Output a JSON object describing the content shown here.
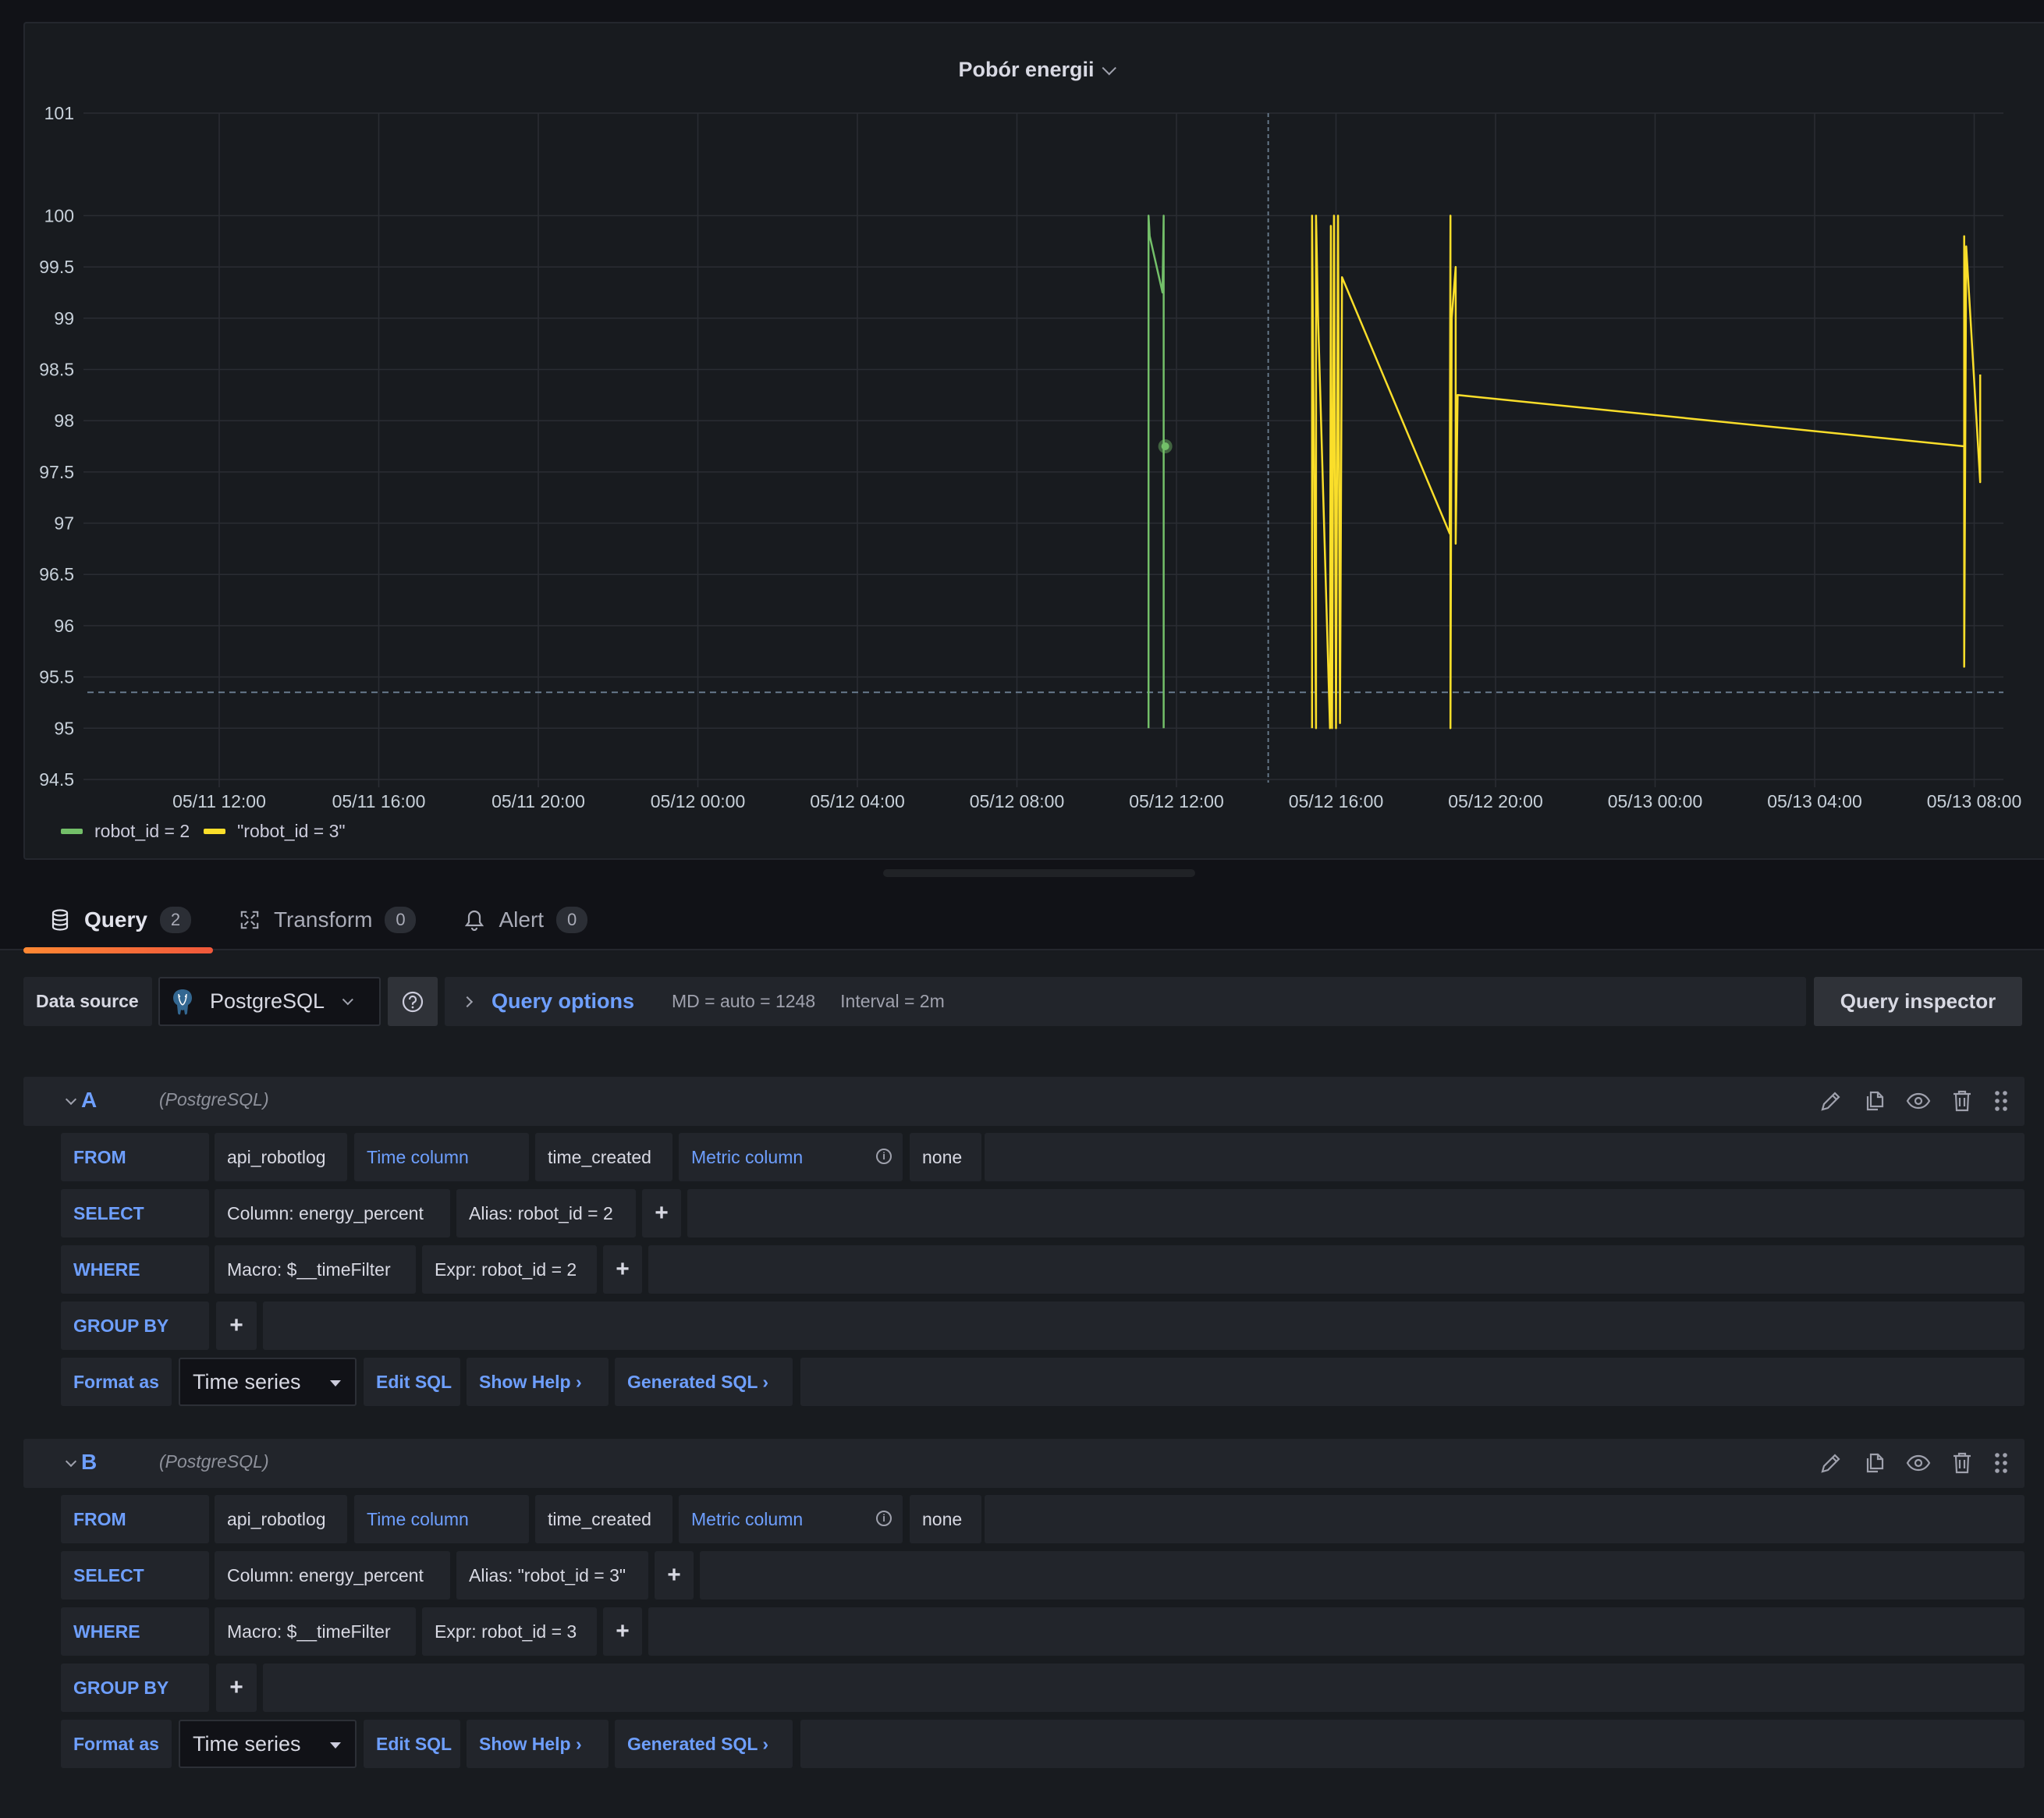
{
  "panel": {
    "title": "Pobór energii"
  },
  "chart_data": {
    "type": "line",
    "title": "Pobór energii",
    "xlabel": "",
    "ylabel": "",
    "ylim": [
      94.5,
      101
    ],
    "y_ticks": [
      "101",
      "100",
      "99.5",
      "99",
      "98.5",
      "98",
      "97.5",
      "97",
      "96.5",
      "96",
      "95.5",
      "95",
      "94.5"
    ],
    "y_tick_values": [
      101,
      100,
      99.5,
      99,
      98.5,
      98,
      97.5,
      97,
      96.5,
      96,
      95.5,
      95,
      94.5
    ],
    "x_ticks": [
      "05/11 12:00",
      "05/11 16:00",
      "05/11 20:00",
      "05/12 00:00",
      "05/12 04:00",
      "05/12 08:00",
      "05/12 12:00",
      "05/12 16:00",
      "05/12 20:00",
      "05/13 00:00",
      "05/13 04:00",
      "05/13 08:00"
    ],
    "x_unit": "hours since 05/11 12:00",
    "grid": true,
    "legend_position": "bottom-left",
    "crosshair_hours": 26.3,
    "crosshair_y": 95.35,
    "series": [
      {
        "name": "robot_id = 2",
        "color": "#73bf69",
        "points": [
          [
            23.3,
            95.0
          ],
          [
            23.3,
            100.0
          ],
          [
            23.33,
            99.8
          ],
          [
            23.65,
            99.25
          ],
          [
            23.68,
            100.0
          ],
          [
            23.68,
            95.0
          ]
        ],
        "highlight": [
          23.68,
          97.75
        ]
      },
      {
        "name": "\"robot_id = 3\"",
        "color": "#fade2a",
        "points": [
          [
            27.4,
            95.0
          ],
          [
            27.4,
            100.0
          ],
          [
            27.5,
            95.0
          ],
          [
            27.5,
            100.0
          ],
          [
            27.55,
            99.0
          ],
          [
            27.85,
            95.0
          ],
          [
            27.87,
            99.9
          ],
          [
            27.9,
            95.0
          ],
          [
            27.95,
            100.0
          ],
          [
            28.0,
            95.0
          ],
          [
            28.05,
            100.0
          ],
          [
            28.1,
            95.05
          ],
          [
            28.15,
            99.4
          ],
          [
            30.85,
            96.9
          ],
          [
            30.87,
            100.0
          ],
          [
            30.87,
            95.0
          ],
          [
            30.9,
            99.0
          ],
          [
            31.0,
            99.5
          ],
          [
            31.0,
            96.8
          ],
          [
            31.05,
            98.25
          ],
          [
            43.75,
            97.75
          ],
          [
            43.75,
            99.8
          ],
          [
            43.75,
            95.6
          ],
          [
            43.8,
            99.7
          ],
          [
            44.15,
            97.4
          ],
          [
            44.15,
            98.45
          ]
        ]
      }
    ]
  },
  "legend": [
    {
      "label": "robot_id = 2",
      "color": "#73bf69"
    },
    {
      "label": "\"robot_id = 3\"",
      "color": "#fade2a"
    }
  ],
  "tabs": [
    {
      "label": "Query",
      "count": "2",
      "icon": "database-icon",
      "active": true
    },
    {
      "label": "Transform",
      "count": "0",
      "icon": "transform-icon",
      "active": false
    },
    {
      "label": "Alert",
      "count": "0",
      "icon": "bell-icon",
      "active": false
    }
  ],
  "toolbar": {
    "datasource_label": "Data source",
    "datasource_value": "PostgreSQL",
    "query_options_label": "Query options",
    "md_text": "MD = auto = 1248",
    "interval_text": "Interval = 2m",
    "query_inspector_label": "Query inspector"
  },
  "queries": [
    {
      "letter": "A",
      "datasource": "(PostgreSQL)",
      "from_kw": "FROM",
      "table": "api_robotlog",
      "time_column_kw": "Time column",
      "time_column": "time_created",
      "metric_column_kw": "Metric column",
      "metric_column": "none",
      "select_kw": "SELECT",
      "select_column": "Column: energy_percent",
      "select_alias": "Alias: robot_id = 2",
      "where_kw": "WHERE",
      "where_macro": "Macro: $__timeFilter",
      "where_expr": "Expr: robot_id = 2",
      "group_by_kw": "GROUP BY",
      "format_as_kw": "Format as",
      "format_value": "Time series",
      "edit_sql": "Edit SQL",
      "show_help": "Show Help",
      "generated_sql": "Generated SQL",
      "plus": "+"
    },
    {
      "letter": "B",
      "datasource": "(PostgreSQL)",
      "from_kw": "FROM",
      "table": "api_robotlog",
      "time_column_kw": "Time column",
      "time_column": "time_created",
      "metric_column_kw": "Metric column",
      "metric_column": "none",
      "select_kw": "SELECT",
      "select_column": "Column: energy_percent",
      "select_alias": "Alias: \"robot_id = 3\"",
      "where_kw": "WHERE",
      "where_macro": "Macro: $__timeFilter",
      "where_expr": "Expr: robot_id = 3",
      "group_by_kw": "GROUP BY",
      "format_as_kw": "Format as",
      "format_value": "Time series",
      "edit_sql": "Edit SQL",
      "show_help": "Show Help",
      "generated_sql": "Generated SQL",
      "plus": "+"
    }
  ]
}
